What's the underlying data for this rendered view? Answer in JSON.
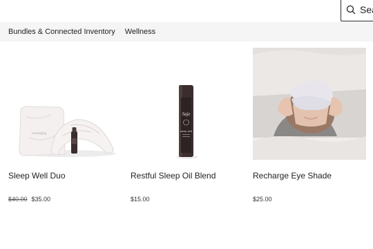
{
  "search": {
    "placeholder": "Search"
  },
  "nav": {
    "items": [
      {
        "label": "Bundles & Connected Inventory"
      },
      {
        "label": "Wellness"
      }
    ]
  },
  "products": [
    {
      "name": "Sleep Well Duo",
      "old_price": "$40.00",
      "price": "$35.00",
      "pouch_text": "recharging"
    },
    {
      "name": "Restful Sleep Oil Blend",
      "price": "$15.00",
      "bottle_brand": "Saje",
      "bottle_label": "sleep well"
    },
    {
      "name": "Recharge Eye Shade",
      "price": "$25.00"
    }
  ],
  "colors": {
    "nav_bg": "#f5f5f5",
    "text": "#222222",
    "bottle": "#3a2d2d"
  }
}
